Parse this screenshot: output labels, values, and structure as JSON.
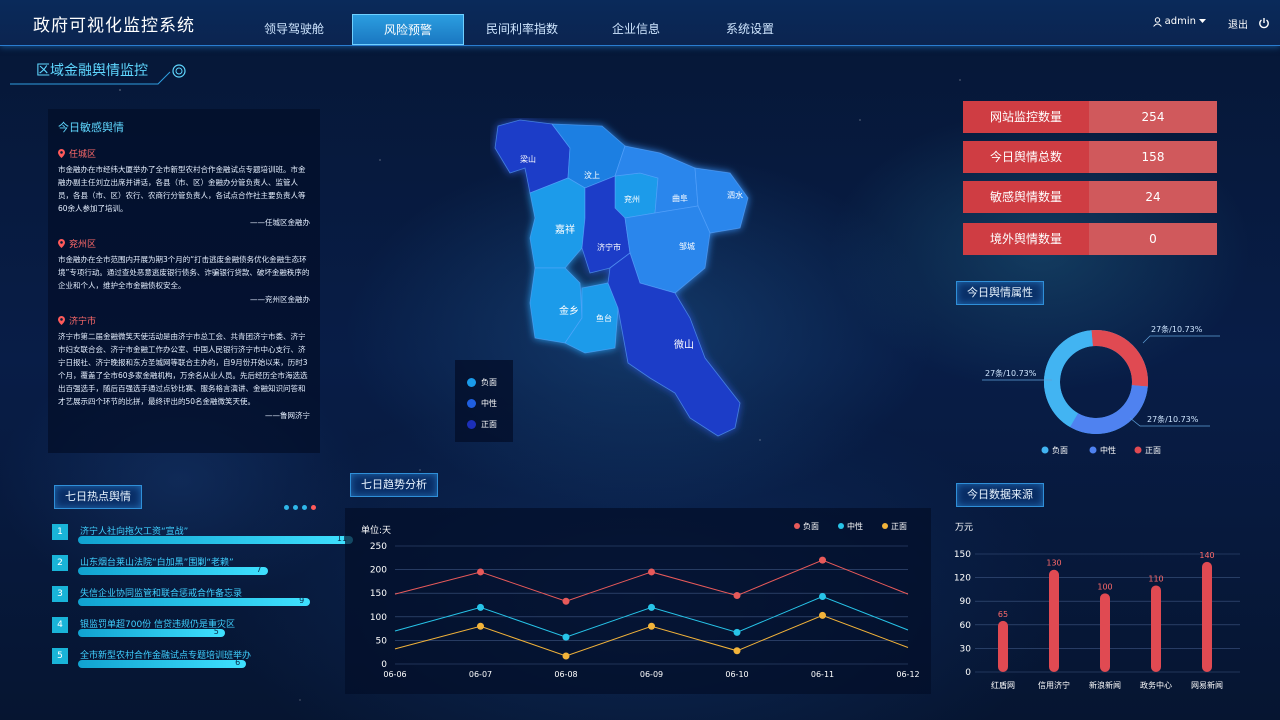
{
  "app": {
    "title": "政府可视化监控系统"
  },
  "nav": [
    {
      "label": "领导驾驶舱",
      "active": false
    },
    {
      "label": "风险预警",
      "active": true
    },
    {
      "label": "民间利率指数",
      "active": false
    },
    {
      "label": "企业信息",
      "active": false
    },
    {
      "label": "系统设置",
      "active": false
    }
  ],
  "user": {
    "name": "admin",
    "logout": "退出"
  },
  "section_title": "区域金融舆情监控",
  "sensitive": {
    "title": "今日敏感舆情",
    "items": [
      {
        "location": "任城区",
        "text": "市金融办在市经纬大厦举办了全市新型农村合作金融试点专题培训班。市金融办副主任刘立出席并讲话，各县（市、区）金融办分管负责人、监管人员，各县（市、区）农行、农商行分管负责人，各试点合作社主要负责人等60余人参加了培训。",
        "source": "——任城区金融办"
      },
      {
        "location": "兖州区",
        "text": "市金融办在全市范围内开展为期3个月的“打击逃废金融债务优化金融生态环境”专项行动。通过查处恶意逃废银行债务、诈骗银行贷款、破坏金融秩序的企业和个人，维护全市金融债权安全。",
        "source": "——兖州区金融办"
      },
      {
        "location": "济宁市",
        "text": "济宁市第二届金融微笑天使活动是由济宁市总工会、共青团济宁市委、济宁市妇女联合会、济宁市金融工作办公室、中国人民银行济宁市中心支行、济宁日报社、济宁晚报和东方圣城网等联合主办的，自9月份开始以来，历时3个月，覆盖了全市60多家金融机构，万余名从业人员。先后经历全市海选选出百强选手，随后百强选手通过点钞比赛、服务格言演讲、金融知识问答和才艺展示四个环节的比拼，最终评出的50名金融微笑天使。",
        "source": "——鲁网济宁"
      }
    ]
  },
  "hot": {
    "title": "七日热点舆情",
    "items": [
      {
        "num": "1",
        "title": "济宁人社向拖欠工资“宣战”",
        "count": "11",
        "value": 11
      },
      {
        "num": "2",
        "title": "山东烟台莱山法院“白加黑”围剿“老赖”",
        "count": "7",
        "value": 7
      },
      {
        "num": "3",
        "title": "失信企业协同监管和联合惩戒合作备忘录",
        "count": "9",
        "value": 9
      },
      {
        "num": "4",
        "title": "银监罚单超700份 信贷违规仍是重灾区",
        "count": "5",
        "value": 5
      },
      {
        "num": "5",
        "title": "全市新型农村合作金融试点专题培训班举办",
        "count": "6",
        "value": 6
      }
    ]
  },
  "map": {
    "regions": [
      "梁山",
      "汶上",
      "兖州",
      "曲阜",
      "泗水",
      "嘉祥",
      "济宁市",
      "邹城",
      "金乡",
      "鱼台",
      "微山"
    ],
    "legend": [
      {
        "label": "负面",
        "color": "#1a9bea"
      },
      {
        "label": "中性",
        "color": "#1f5fe0"
      },
      {
        "label": "正面",
        "color": "#1c2fb8"
      }
    ]
  },
  "stats": [
    {
      "label": "网站监控数量",
      "value": "254"
    },
    {
      "label": "今日舆情总数",
      "value": "158"
    },
    {
      "label": "敏感舆情数量",
      "value": "24"
    },
    {
      "label": "境外舆情数量",
      "value": "0"
    }
  ],
  "attribute": {
    "title": "今日舆情属性",
    "labels": [
      "27条/10.73%",
      "27条/10.73%",
      "27条/10.73%"
    ],
    "legend": [
      {
        "label": "负面",
        "color": "#42b4f2"
      },
      {
        "label": "中性",
        "color": "#4f82f0"
      },
      {
        "label": "正面",
        "color": "#e04a52"
      }
    ]
  },
  "trend": {
    "title": "七日趋势分析",
    "chart_data": {
      "type": "line",
      "ylabel": "单位:天",
      "x": [
        "06-06",
        "06-07",
        "06-08",
        "06-09",
        "06-10",
        "06-11",
        "06-12"
      ],
      "ylim": [
        0,
        250
      ],
      "yticks": [
        0,
        50,
        100,
        150,
        200,
        250
      ],
      "series": [
        {
          "name": "负面",
          "color": "#e85a5a",
          "values": [
            148,
            195,
            133,
            195,
            145,
            220,
            148
          ]
        },
        {
          "name": "中性",
          "color": "#27c4e8",
          "values": [
            70,
            120,
            57,
            120,
            67,
            143,
            72
          ]
        },
        {
          "name": "正面",
          "color": "#f2b33a",
          "values": [
            32,
            80,
            17,
            80,
            28,
            103,
            35
          ]
        }
      ]
    }
  },
  "source": {
    "title": "今日数据来源",
    "chart_data": {
      "type": "bar",
      "ylabel": "万元",
      "categories": [
        "红盾网",
        "信用济宁",
        "新浪新闻",
        "政务中心",
        "网易新闻"
      ],
      "values": [
        65,
        130,
        100,
        110,
        140
      ],
      "ylim": [
        0,
        150
      ],
      "yticks": [
        0,
        30,
        60,
        90,
        120,
        150
      ],
      "color": "#e04a52"
    }
  }
}
